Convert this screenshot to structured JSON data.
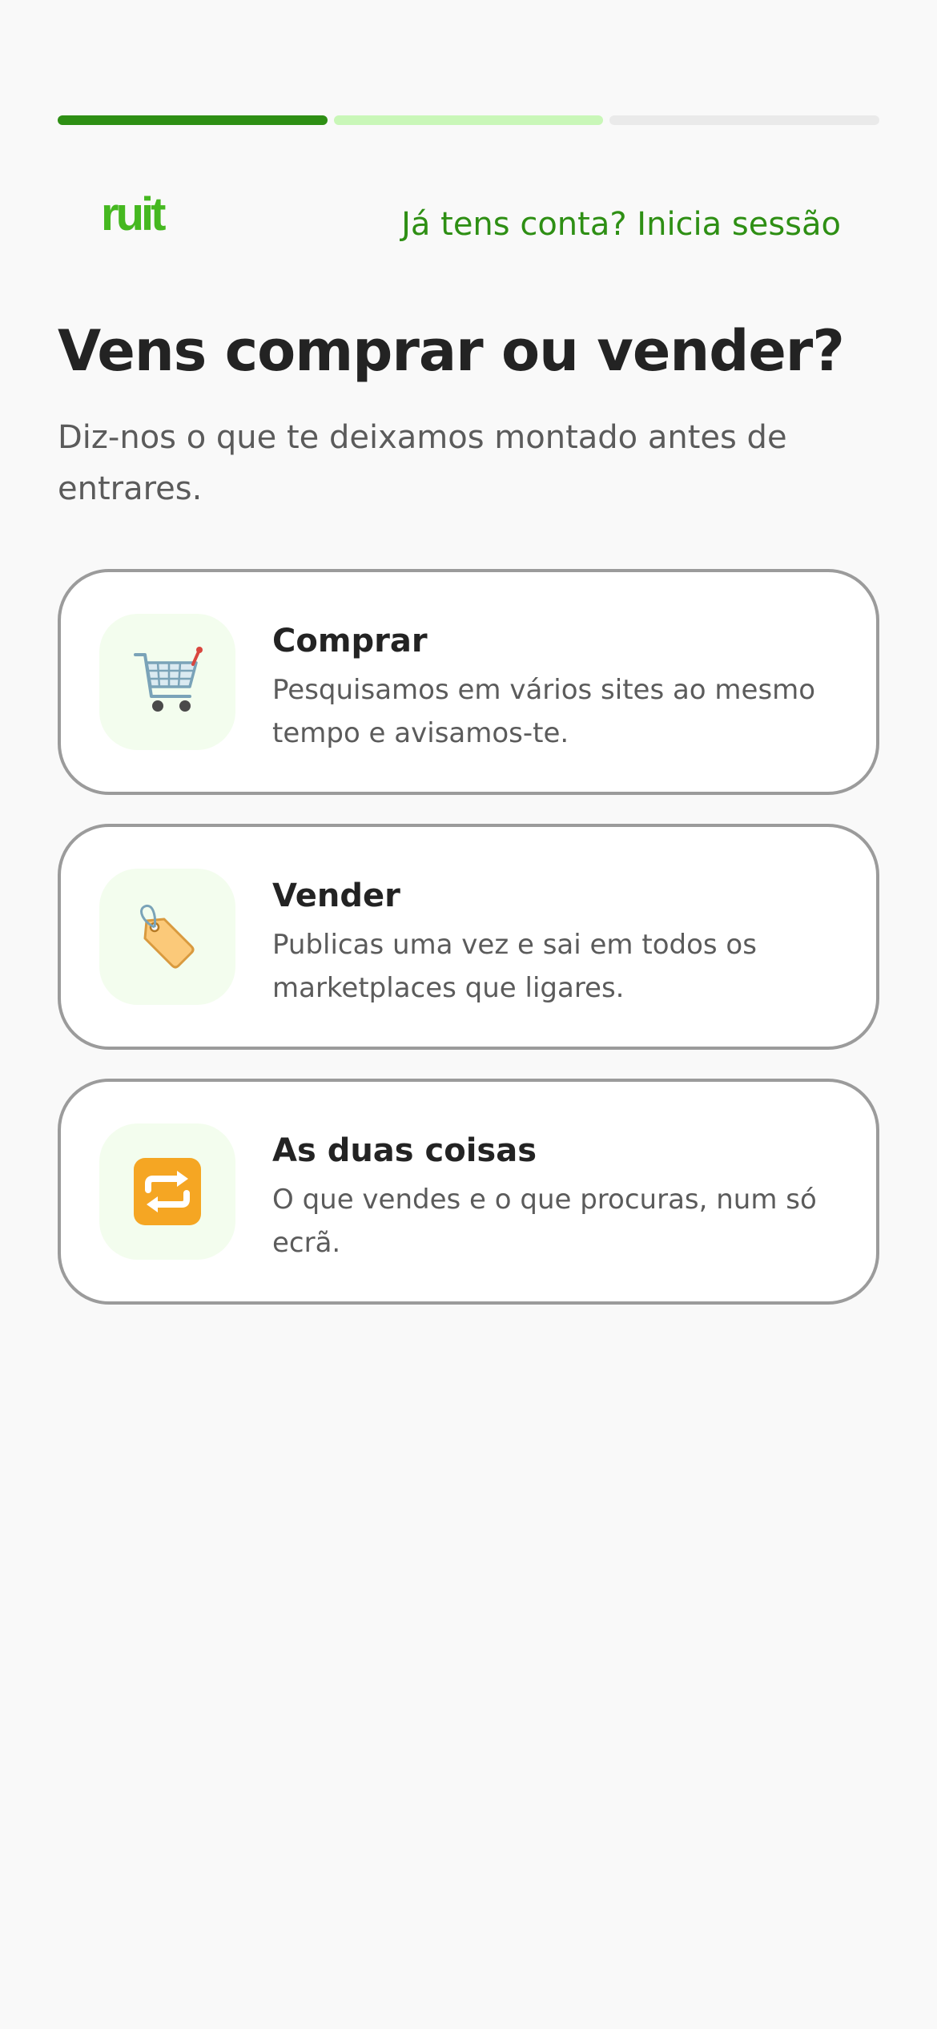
{
  "progress": {
    "total_steps": 3,
    "current_step": 1
  },
  "header": {
    "logo_text": "ruit",
    "login_link": "Já tens conta? Inicia sessão"
  },
  "main": {
    "title": "Vens comprar ou vender?",
    "subtitle": "Diz-nos o que te deixamos montado antes de entrares."
  },
  "options": [
    {
      "icon": "shopping-cart-icon",
      "title": "Comprar",
      "description": "Pesquisamos em vários sites ao mesmo tempo e avisamos-te."
    },
    {
      "icon": "price-tag-icon",
      "title": "Vender",
      "description": "Publicas uma vez e sai em todos os marketplaces que ligares."
    },
    {
      "icon": "repeat-arrows-icon",
      "title": "As duas coisas",
      "description": "O que vendes e o que procuras, num só ecrã."
    }
  ],
  "colors": {
    "accent": "#2e8f14",
    "logo": "#45b820",
    "progress_next": "#c9f7b8",
    "progress_empty": "#eaeaea",
    "icon_tile": "#f3fdee"
  }
}
